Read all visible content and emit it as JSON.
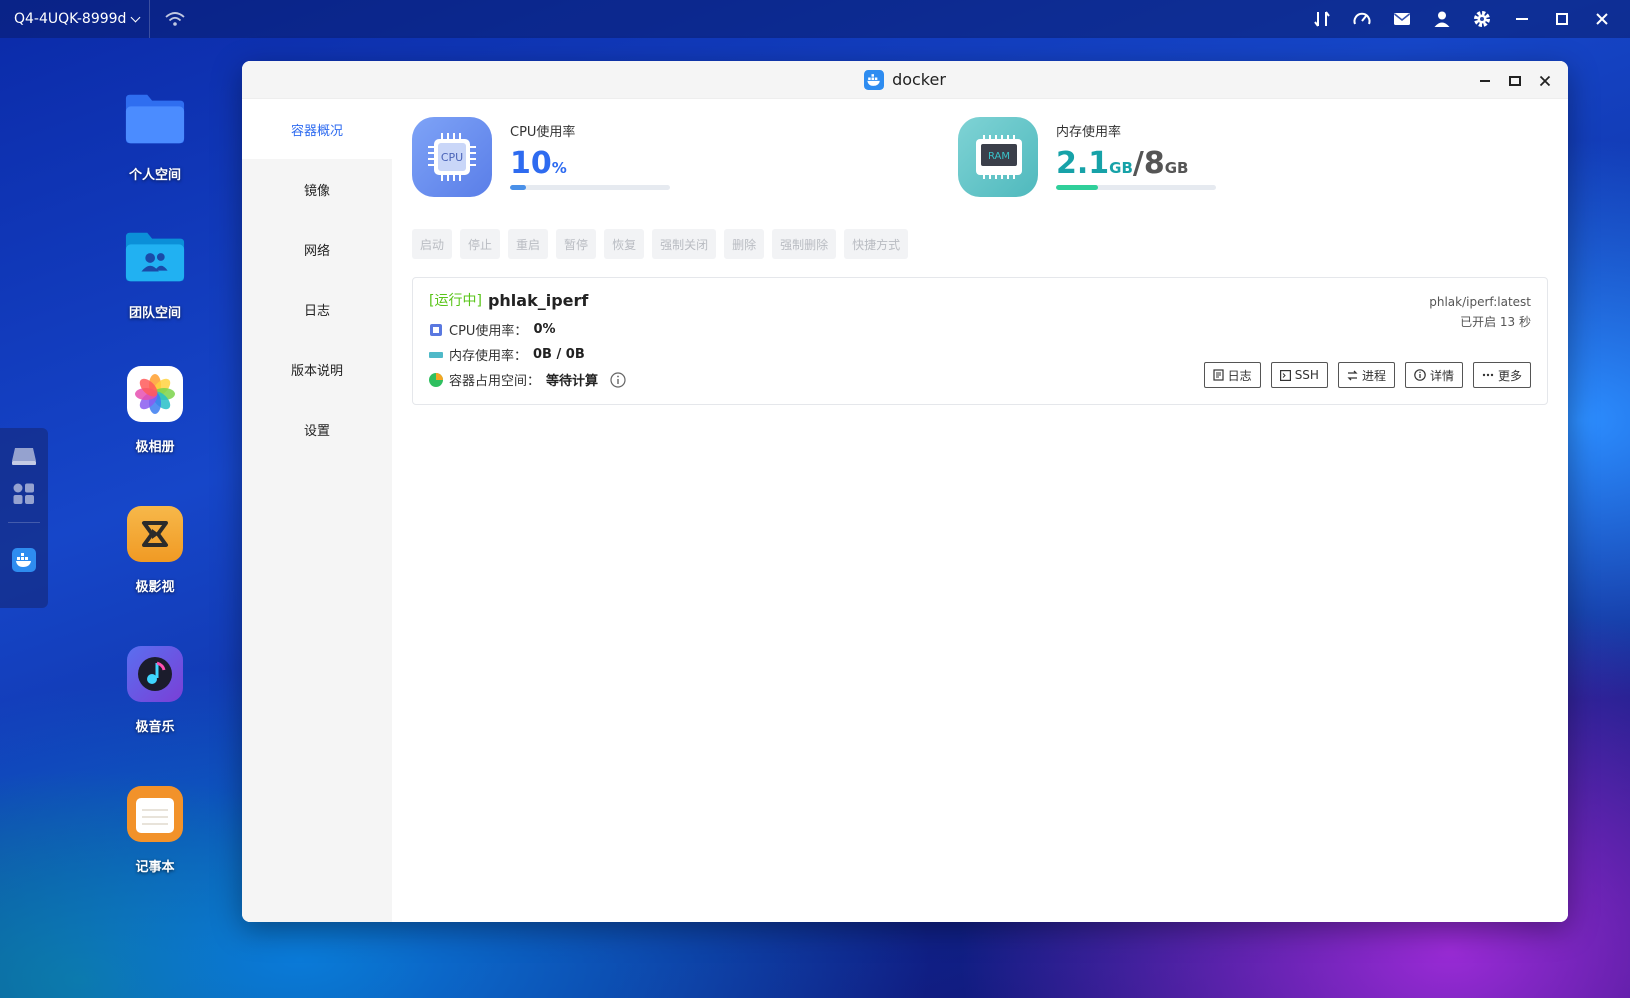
{
  "topbar": {
    "device_name": "Q4-4UQK-8999d",
    "icons": [
      "transfer-icon",
      "speed-gauge-icon",
      "mail-icon",
      "user-icon",
      "gear-icon",
      "minimize-icon",
      "restore-icon",
      "close-icon"
    ]
  },
  "desktop": {
    "items": [
      {
        "label": "个人空间",
        "icon": "folder-icon"
      },
      {
        "label": "团队空间",
        "icon": "team-folder-icon"
      },
      {
        "label": "极相册",
        "icon": "photos-icon"
      },
      {
        "label": "极影视",
        "icon": "video-icon"
      },
      {
        "label": "极音乐",
        "icon": "music-icon"
      },
      {
        "label": "记事本",
        "icon": "notepad-icon"
      }
    ]
  },
  "window": {
    "title": "docker",
    "sidebar": {
      "items": [
        "容器概况",
        "镜像",
        "网络",
        "日志",
        "版本说明",
        "设置"
      ],
      "active_index": 0
    },
    "cpu": {
      "label": "CPU使用率",
      "value": "10",
      "unit": "%",
      "percent": 10,
      "icon_text": "CPU",
      "accent": "#2e6bf0"
    },
    "memory": {
      "label": "内存使用率",
      "used": "2.1",
      "used_unit": "GB",
      "separator": "/",
      "total": "8",
      "total_unit": "GB",
      "percent": 26,
      "icon_text": "RAM",
      "accent": "#17a2a8"
    },
    "actions": [
      "启动",
      "停止",
      "重启",
      "暂停",
      "恢复",
      "强制关闭",
      "删除",
      "强制删除",
      "快捷方式"
    ],
    "container": {
      "status": "[运行中]",
      "name": "phlak_iperf",
      "cpu_label": "CPU使用率：",
      "cpu_value": "0%",
      "mem_label": "内存使用率：",
      "mem_value": "0B / 0B",
      "disk_label": "容器占用空间：",
      "disk_value": "等待计算",
      "image": "phlak/iperf:latest",
      "uptime": "已开启 13 秒",
      "buttons": [
        "日志",
        "SSH",
        "进程",
        "详情",
        "更多"
      ]
    }
  }
}
